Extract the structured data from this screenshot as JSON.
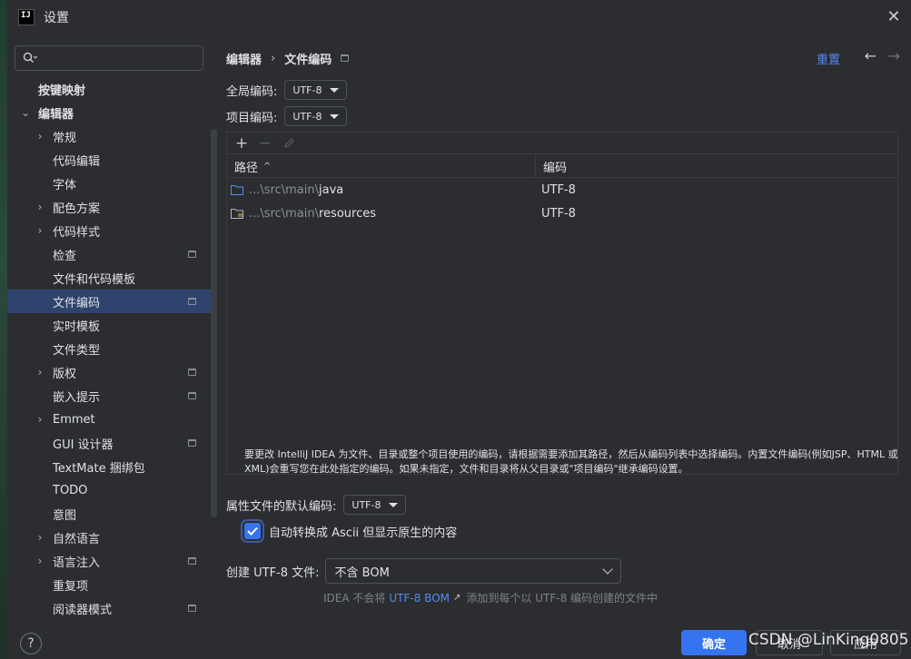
{
  "window": {
    "title": "设置",
    "logo_text": "IJ"
  },
  "search": {
    "placeholder": "",
    "value": ""
  },
  "sidebar": {
    "items": [
      {
        "label": "按键映射"
      },
      {
        "label": "编辑器"
      },
      {
        "label": "常规"
      },
      {
        "label": "代码编辑"
      },
      {
        "label": "字体"
      },
      {
        "label": "配色方案"
      },
      {
        "label": "代码样式"
      },
      {
        "label": "检查"
      },
      {
        "label": "文件和代码模板"
      },
      {
        "label": "文件编码"
      },
      {
        "label": "实时模板"
      },
      {
        "label": "文件类型"
      },
      {
        "label": "版权"
      },
      {
        "label": "嵌入提示"
      },
      {
        "label": "Emmet"
      },
      {
        "label": "GUI 设计器"
      },
      {
        "label": "TextMate 捆绑包"
      },
      {
        "label": "TODO"
      },
      {
        "label": "意图"
      },
      {
        "label": "自然语言"
      },
      {
        "label": "语言注入"
      },
      {
        "label": "重复项"
      },
      {
        "label": "阅读器模式"
      }
    ]
  },
  "breadcrumb": {
    "parent": "编辑器",
    "separator": "›",
    "current": "文件编码"
  },
  "header": {
    "reset_label": "重置"
  },
  "global_encoding": {
    "label": "全局编码:",
    "value": "UTF-8"
  },
  "project_encoding": {
    "label": "项目编码:",
    "value": "UTF-8"
  },
  "table": {
    "columns": [
      "路径",
      "编码"
    ],
    "rows": [
      {
        "path_prefix": "...\\src\\main\\",
        "path_name": "java",
        "encoding": "UTF-8"
      },
      {
        "path_prefix": "...\\src\\main\\",
        "path_name": "resources",
        "encoding": "UTF-8"
      }
    ]
  },
  "help_text": "要更改 IntelliJ IDEA 为文件、目录或整个项目使用的编码，请根据需要添加其路径，然后从编码列表中选择编码。内置文件编码(例如JSP、HTML 或 XML)会重写您在此处指定的编码。如果未指定，文件和目录将从父目录或\"项目编码\"继承编码设置。",
  "properties": {
    "label": "属性文件的默认编码:",
    "value": "UTF-8",
    "checkbox_label": "自动转换成 Ascii 但显示原生的内容",
    "checkbox_checked": true
  },
  "bom": {
    "label": "创建 UTF-8 文件:",
    "value": "不含 BOM",
    "note_prefix": "IDEA 不会将",
    "note_link": "UTF-8 BOM",
    "note_arrow": "↗",
    "note_suffix": "添加到每个以 UTF-8 编码创建的文件中"
  },
  "footer": {
    "help": "?",
    "ok": "确定",
    "cancel": "取消",
    "apply": "应用"
  },
  "watermark": "CSDN @LinKing0805",
  "colors": {
    "accent": "#3574f0",
    "link": "#548af7",
    "background": "#2b2d30",
    "selection": "#2e436e"
  }
}
